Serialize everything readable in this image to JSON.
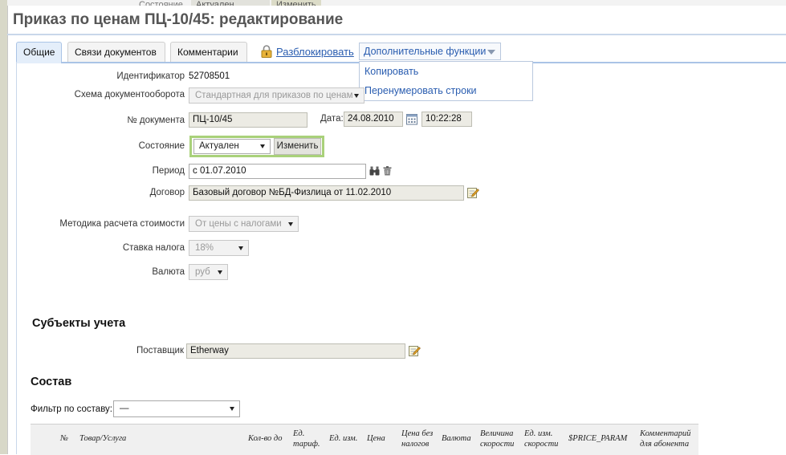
{
  "background": {
    "state_label": "Состояние",
    "state_value": "Актуален",
    "change_label": "Изменить"
  },
  "window": {
    "title": "Приказ по ценам ПЦ-10/45: редактирование"
  },
  "tabs": [
    {
      "label": "Общие",
      "active": true
    },
    {
      "label": "Связи документов",
      "active": false
    },
    {
      "label": "Комментарии",
      "active": false
    }
  ],
  "toolbar": {
    "unlock_label": "Разблокировать",
    "more_label": "Дополнительные функции",
    "menu_items": [
      "Копировать",
      "Перенумеровать строки"
    ]
  },
  "form": {
    "id_label": "Идентификатор",
    "id_value": "52708501",
    "workflow_label": "Схема документооборота",
    "workflow_value": "Стандартная для приказов по ценам",
    "docnum_label": "№ документа",
    "docnum_value": "ПЦ-10/45",
    "date_label": "Дата:",
    "date_value": "24.08.2010",
    "time_value": "10:22:28",
    "state_label": "Состояние",
    "state_value": "Актуален",
    "state_button": "Изменить",
    "period_label": "Период",
    "period_value": "с 01.07.2010",
    "contract_label": "Договор",
    "contract_value": "Базовый договор №БД-Физлица от 11.02.2010",
    "method_label": "Методика расчета стоимости",
    "method_value": "От цены с налогами",
    "tax_label": "Ставка налога",
    "tax_value": "18%",
    "currency_label": "Валюта",
    "currency_value": "руб"
  },
  "subjects": {
    "heading": "Субъекты учета",
    "supplier_label": "Поставщик",
    "supplier_value": "Etherway"
  },
  "composition": {
    "heading": "Состав",
    "filter_label": "Фильтр по составу:",
    "filter_value": "—",
    "columns": [
      "№",
      "Товар/Услуга",
      "Кол-во до",
      "Ед. тариф.",
      "Ед. изм.",
      "Цена",
      "Цена без налогов",
      "Валюта",
      "Величина скорости",
      "Ед. изм. скорости",
      "$PRICE_PARAM",
      "Комментарий для абонента"
    ]
  }
}
